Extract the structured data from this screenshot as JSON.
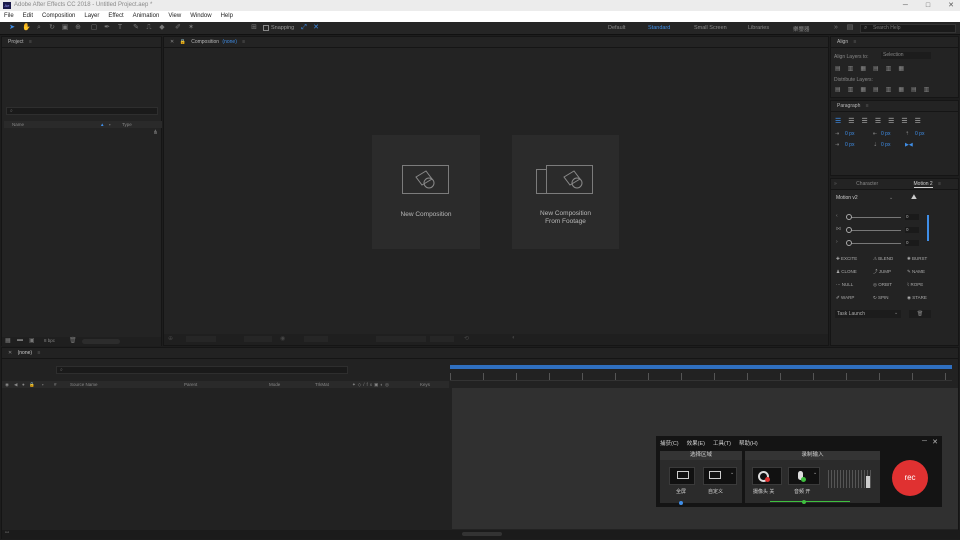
{
  "window": {
    "app_icon": "Ae",
    "title": "Adobe After Effects CC 2018 - Untitled Project.aep *",
    "controls": [
      "minimize-icon",
      "maximize-icon",
      "close-icon"
    ],
    "control_glyphs": [
      "─",
      "□",
      "✕"
    ]
  },
  "menu": [
    "File",
    "Edit",
    "Composition",
    "Layer",
    "Effect",
    "Animation",
    "View",
    "Window",
    "Help"
  ],
  "toolbar": {
    "snapping_label": "Snapping",
    "workspaces": [
      "Default",
      "Standard",
      "Small Screen",
      "Libraries",
      "樂鑒器"
    ],
    "active_workspace": "Standard",
    "search_placeholder": "Search Help"
  },
  "project_panel": {
    "title": "Project",
    "col_name": "Name",
    "col_type": "Type",
    "bpc": "8 bpc"
  },
  "composition_panel": {
    "tab_label": "Composition",
    "tab_value": "(none)",
    "new_comp_label": "New Composition",
    "new_comp_footage_line1": "New Composition",
    "new_comp_footage_line2": "From Footage"
  },
  "align_panel": {
    "title": "Align",
    "align_to_label": "Align Layers to:",
    "align_to_value": "Selection",
    "distribute_label": "Distribute Layers:"
  },
  "paragraph_panel": {
    "title": "Paragraph",
    "values": [
      "0 px",
      "0 px",
      "0 px",
      "0 px",
      "0 px"
    ]
  },
  "character_tab": "Character",
  "motion_panel": {
    "tab": "Motion 2",
    "version": "Motion v2",
    "slider_values": [
      "0",
      "0",
      "0"
    ],
    "buttons": [
      "EXCITE",
      "BLEND",
      "BURST",
      "CLONE",
      "JUMP",
      "NAME",
      "NULL",
      "ORBIT",
      "ROPE",
      "WARP",
      "SPIN",
      "STARE"
    ],
    "task_launch": "Task Launch"
  },
  "timeline": {
    "tab": "(none)",
    "cols": [
      "Source Name",
      "Parent",
      "Mode",
      "TrkMat",
      "Keys"
    ]
  },
  "recorder": {
    "menu": [
      "捕获(C)",
      "效果(E)",
      "工具(T)",
      "帮助(H)"
    ],
    "group1_title": "选择区域",
    "group2_title": "录制输入",
    "fullscreen_label": "全屏",
    "custom_label": "自定义",
    "camera_label": "摄像头 关",
    "audio_label": "音频 开",
    "rec_label": "rec"
  },
  "colors": {
    "accent": "#3f8ee8",
    "rec_red": "#e03131"
  }
}
